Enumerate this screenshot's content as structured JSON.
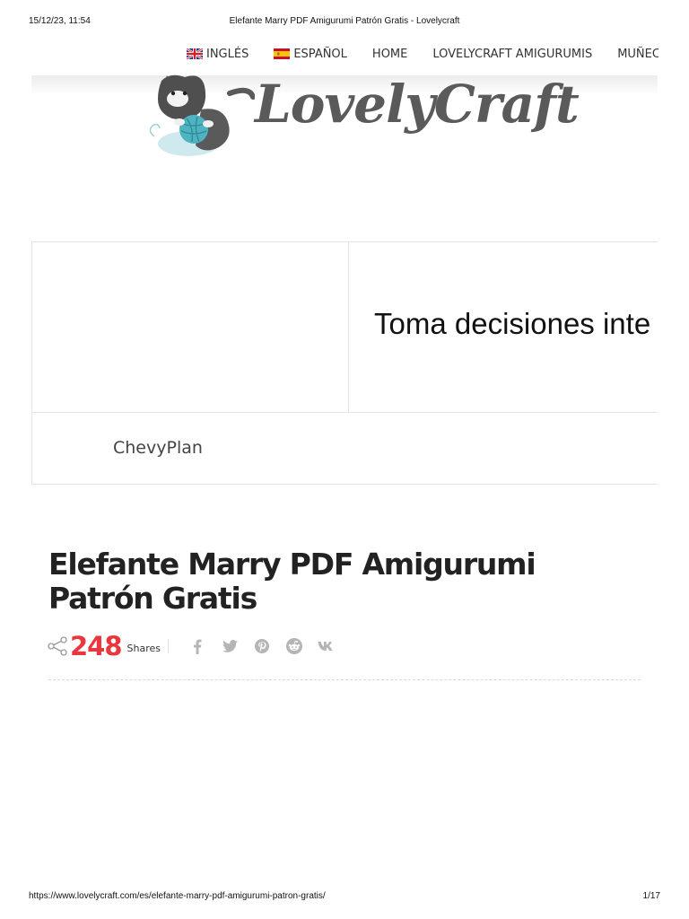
{
  "print_header": {
    "datetime": "15/12/23, 11:54",
    "document_title": "Elefante Marry PDF Amigurumi Patrón Gratis - Lovelycraft"
  },
  "nav": {
    "items": [
      {
        "label": "INGLÉS",
        "icon": "uk-flag-icon"
      },
      {
        "label": "ESPAÑOL",
        "icon": "spain-flag-icon"
      },
      {
        "label": "HOME"
      },
      {
        "label": "LOVELYCRAFT AMIGURUMIS"
      },
      {
        "label": "MUÑECA"
      }
    ]
  },
  "logo": {
    "text": "LovelyCraft",
    "icon": "cat-with-yarn-icon"
  },
  "ad": {
    "headline": "Toma decisiones inte",
    "brand": "ChevyPlan"
  },
  "post": {
    "title": "Elefante Marry PDF Amigurumi Patrón Gratis",
    "share_count": "248",
    "share_label": "Shares",
    "social_icons": [
      "facebook-icon",
      "twitter-icon",
      "pinterest-icon",
      "reddit-icon",
      "vk-icon"
    ]
  },
  "print_footer": {
    "url": "https://www.lovelycraft.com/es/elefante-marry-pdf-amigurumi-patron-gratis/",
    "page": "1/17"
  },
  "colors": {
    "share_count": "#e8383d",
    "logo_text": "#5a5a5a",
    "icon_gray": "#b5b5b5"
  }
}
